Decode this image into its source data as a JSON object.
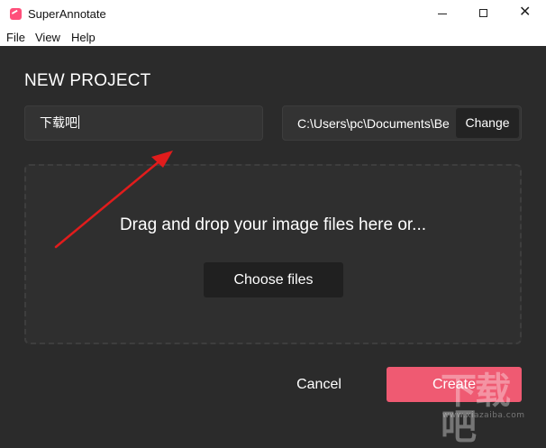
{
  "window": {
    "title": "SuperAnnotate",
    "controls": {
      "minimize": "—",
      "maximize": "□",
      "close": "✕"
    }
  },
  "menu": {
    "items": [
      {
        "label": "File"
      },
      {
        "label": "View"
      },
      {
        "label": "Help"
      }
    ]
  },
  "dialog": {
    "heading": "NEW PROJECT",
    "project_name_value": "下载吧",
    "path_value": "C:\\Users\\pc\\Documents\\Be",
    "change_label": "Change",
    "dropzone_text": "Drag and drop your image files here or...",
    "choose_files_label": "Choose files",
    "cancel_label": "Cancel",
    "create_label": "Create"
  },
  "colors": {
    "background": "#2b2b2b",
    "accent": "#ef5a72",
    "annotation_arrow": "#e11c1c",
    "brand_icon": "#ff4f7a"
  },
  "watermark": {
    "main": "下载吧",
    "sub": "www.xiazaiba.com"
  }
}
